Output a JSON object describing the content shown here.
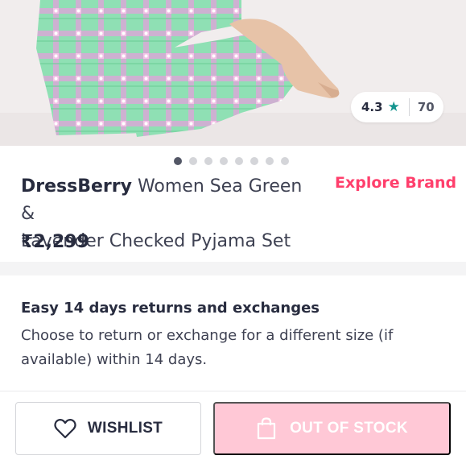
{
  "product": {
    "rating": "4.3",
    "rating_count": "70",
    "image_count": 8,
    "active_image_index": 0,
    "brand": "DressBerry",
    "name_line1": "Women Sea Green &",
    "name_line2": "Lavender Checked Pyjama Set",
    "price": "₹2,299"
  },
  "actions": {
    "explore_brand": "Explore Brand",
    "wishlist": "WISHLIST",
    "out_of_stock": "OUT OF STOCK"
  },
  "returns": {
    "title": "Easy 14 days returns and exchanges",
    "description": "Choose to return or exchange for a different size (if available) within 14 days."
  },
  "colors": {
    "accent": "#ff3f6c",
    "rating_star": "#14958f",
    "out_of_stock_bg": "#ffc8d6"
  },
  "icons": {
    "rating": "star-icon",
    "wishlist": "heart-icon",
    "bag": "shopping-bag-icon"
  }
}
